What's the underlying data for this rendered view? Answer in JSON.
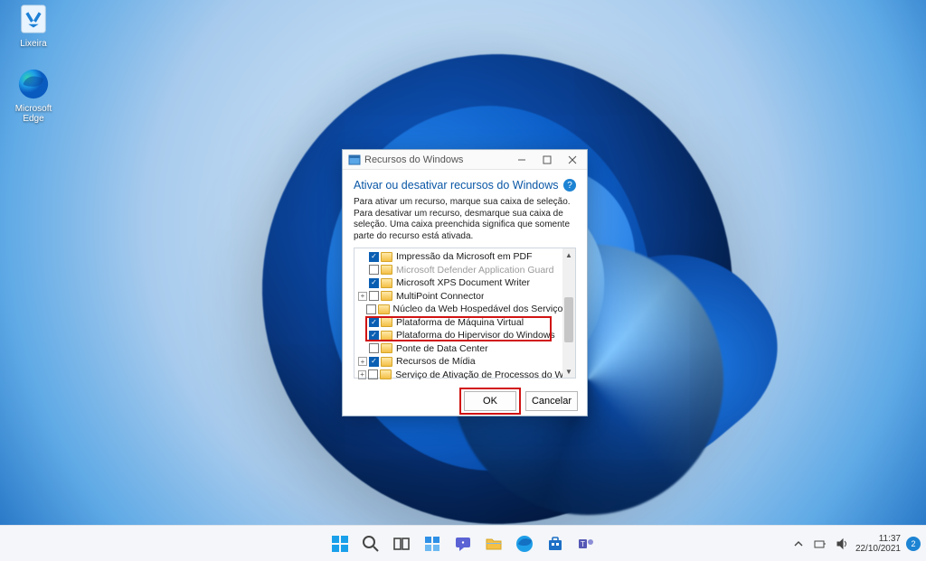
{
  "desktop": {
    "icons": [
      {
        "label": "Lixeira"
      },
      {
        "label": "Microsoft Edge"
      }
    ]
  },
  "dialog": {
    "title": "Recursos do Windows",
    "heading": "Ativar ou desativar recursos do Windows",
    "description": "Para ativar um recurso, marque sua caixa de seleção. Para desativar um recurso, desmarque sua caixa de seleção. Uma caixa preenchida significa que somente parte do recurso está ativada.",
    "features": [
      {
        "label": "Impressão da Microsoft em PDF",
        "checked": true,
        "expandable": false,
        "disabled": false
      },
      {
        "label": "Microsoft Defender Application Guard",
        "checked": false,
        "expandable": false,
        "disabled": true
      },
      {
        "label": "Microsoft XPS Document Writer",
        "checked": true,
        "expandable": false,
        "disabled": false
      },
      {
        "label": "MultiPoint Connector",
        "checked": false,
        "expandable": true,
        "disabled": false
      },
      {
        "label": "Núcleo da Web Hospedável dos Serviços de Informações da",
        "checked": false,
        "expandable": false,
        "disabled": false
      },
      {
        "label": "Plataforma de Máquina Virtual",
        "checked": true,
        "expandable": false,
        "disabled": false
      },
      {
        "label": "Plataforma do Hipervisor do Windows",
        "checked": true,
        "expandable": false,
        "disabled": false
      },
      {
        "label": "Ponte de Data Center",
        "checked": false,
        "expandable": false,
        "disabled": false
      },
      {
        "label": "Recursos de Mídia",
        "checked": true,
        "expandable": true,
        "disabled": false
      },
      {
        "label": "Serviço de Ativação de Processos do Windows",
        "checked": false,
        "expandable": true,
        "disabled": false
      }
    ],
    "buttons": {
      "ok": "OK",
      "cancel": "Cancelar"
    }
  },
  "taskbar": {
    "icons": [
      "start",
      "search",
      "task-view",
      "widgets",
      "chat",
      "explorer",
      "edge",
      "store",
      "teams"
    ],
    "tray": {
      "time": "11:37",
      "date": "22/10/2021",
      "badge": "2"
    }
  }
}
